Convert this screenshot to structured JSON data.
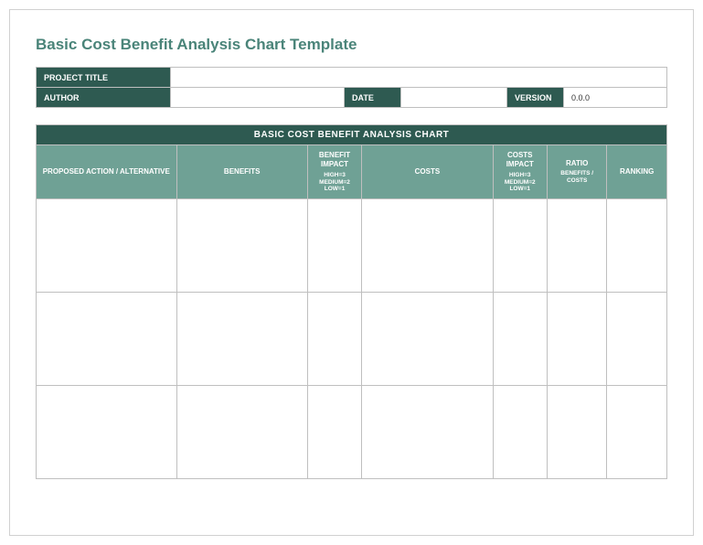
{
  "title": "Basic Cost Benefit Analysis Chart Template",
  "meta": {
    "project_title_label": "PROJECT TITLE",
    "project_title_value": "",
    "author_label": "AUTHOR",
    "author_value": "",
    "date_label": "DATE",
    "date_value": "",
    "version_label": "VERSION",
    "version_value": "0.0.0"
  },
  "chart": {
    "heading": "BASIC COST BENEFIT ANALYSIS CHART",
    "columns": {
      "action": "PROPOSED ACTION / ALTERNATIVE",
      "benefits": "BENEFITS",
      "benefit_impact": "BENEFIT IMPACT",
      "benefit_impact_sub": "HIGH=3 MEDIUM=2 LOW=1",
      "costs": "COSTS",
      "costs_impact": "COSTS IMPACT",
      "costs_impact_sub": "HIGH=3 MEDIUM=2 LOW=1",
      "ratio": "RATIO",
      "ratio_sub": "BENEFITS / COSTS",
      "ranking": "RANKING"
    },
    "rows": [
      {
        "action": "",
        "benefits": "",
        "benefit_impact": "",
        "costs": "",
        "costs_impact": "",
        "ratio": "",
        "ranking": ""
      },
      {
        "action": "",
        "benefits": "",
        "benefit_impact": "",
        "costs": "",
        "costs_impact": "",
        "ratio": "",
        "ranking": ""
      },
      {
        "action": "",
        "benefits": "",
        "benefit_impact": "",
        "costs": "",
        "costs_impact": "",
        "ratio": "",
        "ranking": ""
      }
    ]
  }
}
